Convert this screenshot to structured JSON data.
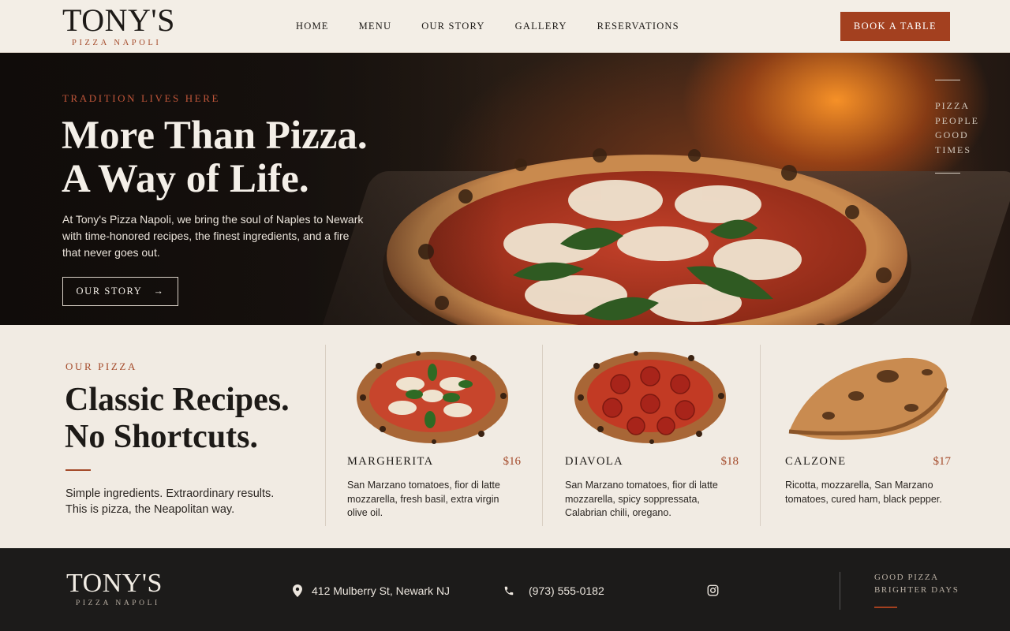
{
  "brand": {
    "name": "TONY'S",
    "tagline": "PIZZA NAPOLI"
  },
  "nav": {
    "items": [
      "HOME",
      "MENU",
      "OUR STORY",
      "GALLERY",
      "RESERVATIONS"
    ],
    "cta": "BOOK A TABLE"
  },
  "hero": {
    "eyebrow": "TRADITION LIVES HERE",
    "title_line1": "More Than Pizza.",
    "title_line2": "A Way of Life.",
    "text": "At Tony's Pizza Napoli, we bring the soul of Naples to Newark with time-honored recipes, the finest ingredients, and a fire that never goes out.",
    "button": "OUR STORY",
    "side_words": [
      "PIZZA",
      "PEOPLE",
      "GOOD",
      "TIMES"
    ]
  },
  "menu": {
    "eyebrow": "OUR PIZZA",
    "title_line1": "Classic Recipes.",
    "title_line2": "No Shortcuts.",
    "text": "Simple ingredients. Extraordinary results. This is pizza, the Neapolitan way.",
    "items": [
      {
        "name": "MARGHERITA",
        "price": "$16",
        "desc": "San Marzano tomatoes, fior di latte mozzarella, fresh basil, extra virgin olive oil.",
        "icon": "margherita-pizza-image"
      },
      {
        "name": "DIAVOLA",
        "price": "$18",
        "desc": "San Marzano tomatoes, fior di latte mozzarella, spicy soppressata, Calabrian chili, oregano.",
        "icon": "diavola-pizza-image"
      },
      {
        "name": "CALZONE",
        "price": "$17",
        "desc": "Ricotta, mozzarella, San Marzano tomatoes, cured ham, black pepper.",
        "icon": "calzone-image"
      }
    ]
  },
  "footer": {
    "address": "412 Mulberry St, Newark NJ",
    "phone": "(973) 555-0182",
    "tag_line1": "GOOD PIZZA",
    "tag_line2": "BRIGHTER DAYS"
  },
  "colors": {
    "accent": "#a3401f",
    "background": "#f1ebe3",
    "footer": "#1c1b1a"
  }
}
